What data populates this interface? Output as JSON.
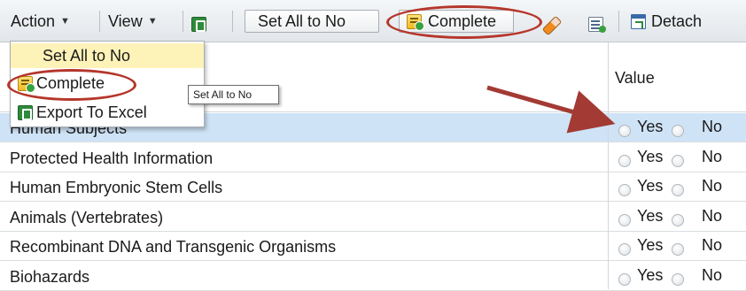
{
  "toolbar": {
    "action_label": "Action",
    "view_label": "View",
    "set_all_no_label": "Set All to No",
    "complete_label": "Complete",
    "detach_label": "Detach"
  },
  "menu": {
    "items": [
      {
        "label": "Set All to No",
        "icon": "none"
      },
      {
        "label": "Complete",
        "icon": "complete-icon"
      },
      {
        "label": "Export To Excel",
        "icon": "excel-icon"
      }
    ]
  },
  "tooltip": {
    "text": "Set All to No"
  },
  "grid": {
    "value_header": "Value",
    "yes_label": "Yes",
    "no_label": "No",
    "rows": [
      {
        "label": "Human Subjects",
        "selected": true
      },
      {
        "label": "Protected Health Information",
        "selected": false
      },
      {
        "label": "Human Embryonic Stem Cells",
        "selected": false
      },
      {
        "label": "Animals (Vertebrates)",
        "selected": false
      },
      {
        "label": "Recombinant DNA and Transgenic Organisms",
        "selected": false
      },
      {
        "label": "Biohazards",
        "selected": false
      }
    ]
  },
  "colors": {
    "highlight_oval": "#b5362a",
    "selected_row": "#cfe3f7",
    "menu_hover": "#fdf2b8",
    "arrow": "#a33a34"
  }
}
